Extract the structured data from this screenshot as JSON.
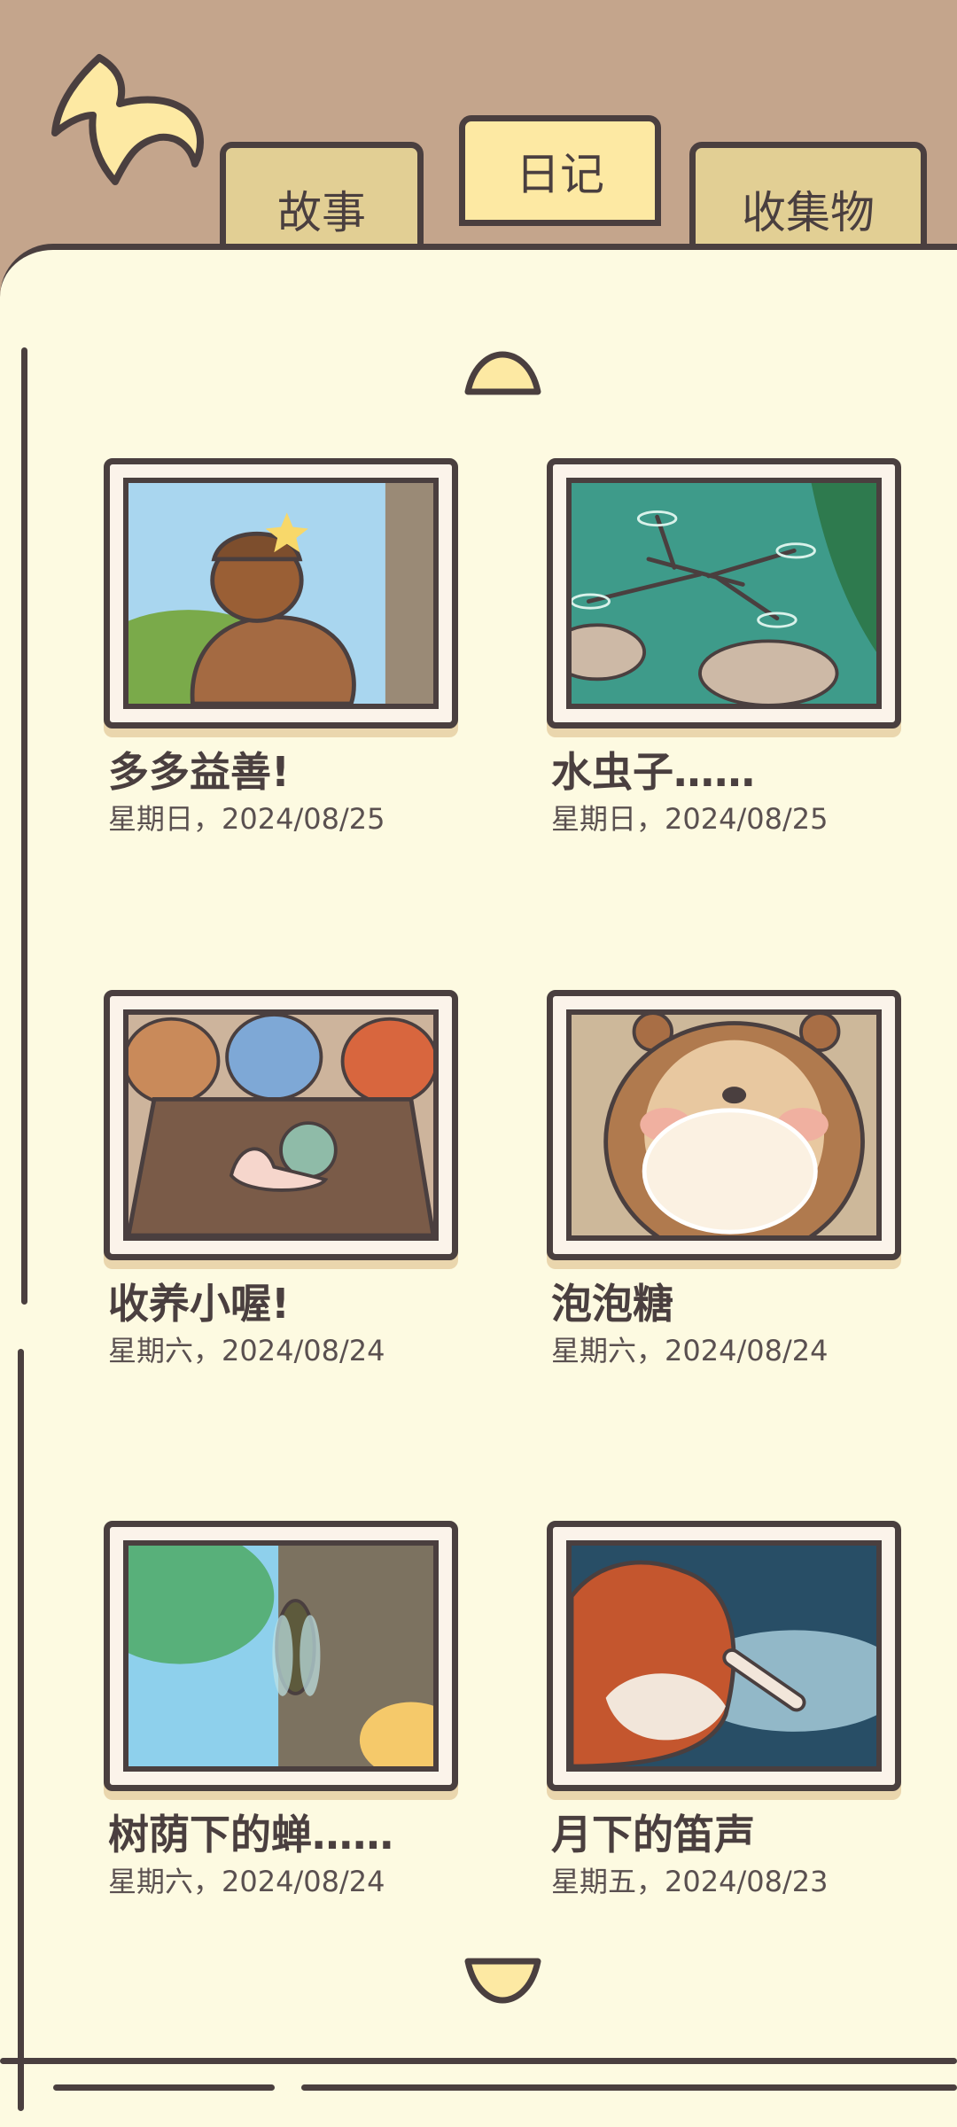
{
  "tabs": [
    {
      "label": "故事",
      "active": false
    },
    {
      "label": "日记",
      "active": true
    },
    {
      "label": "收集物",
      "active": false
    }
  ],
  "entries": [
    {
      "title": "多多益善!",
      "date": "星期日，2024/08/25"
    },
    {
      "title": "水虫子……",
      "date": "星期日，2024/08/25"
    },
    {
      "title": "收养小喔!",
      "date": "星期六，2024/08/24"
    },
    {
      "title": "泡泡糖",
      "date": "星期六，2024/08/24"
    },
    {
      "title": "树荫下的蝉……",
      "date": "星期六，2024/08/24"
    },
    {
      "title": "月下的笛声",
      "date": "星期五，2024/08/23"
    }
  ],
  "colors": {
    "outline": "#4a3f3f",
    "paper": "#fdfae1",
    "header_bg": "#c4a58c",
    "tab_inactive": "#e2cf94",
    "tab_active": "#fde9a3"
  },
  "icons": {
    "back": "back-arrow-icon",
    "scroll_up": "scroll-up-icon",
    "scroll_down": "scroll-down-icon"
  }
}
